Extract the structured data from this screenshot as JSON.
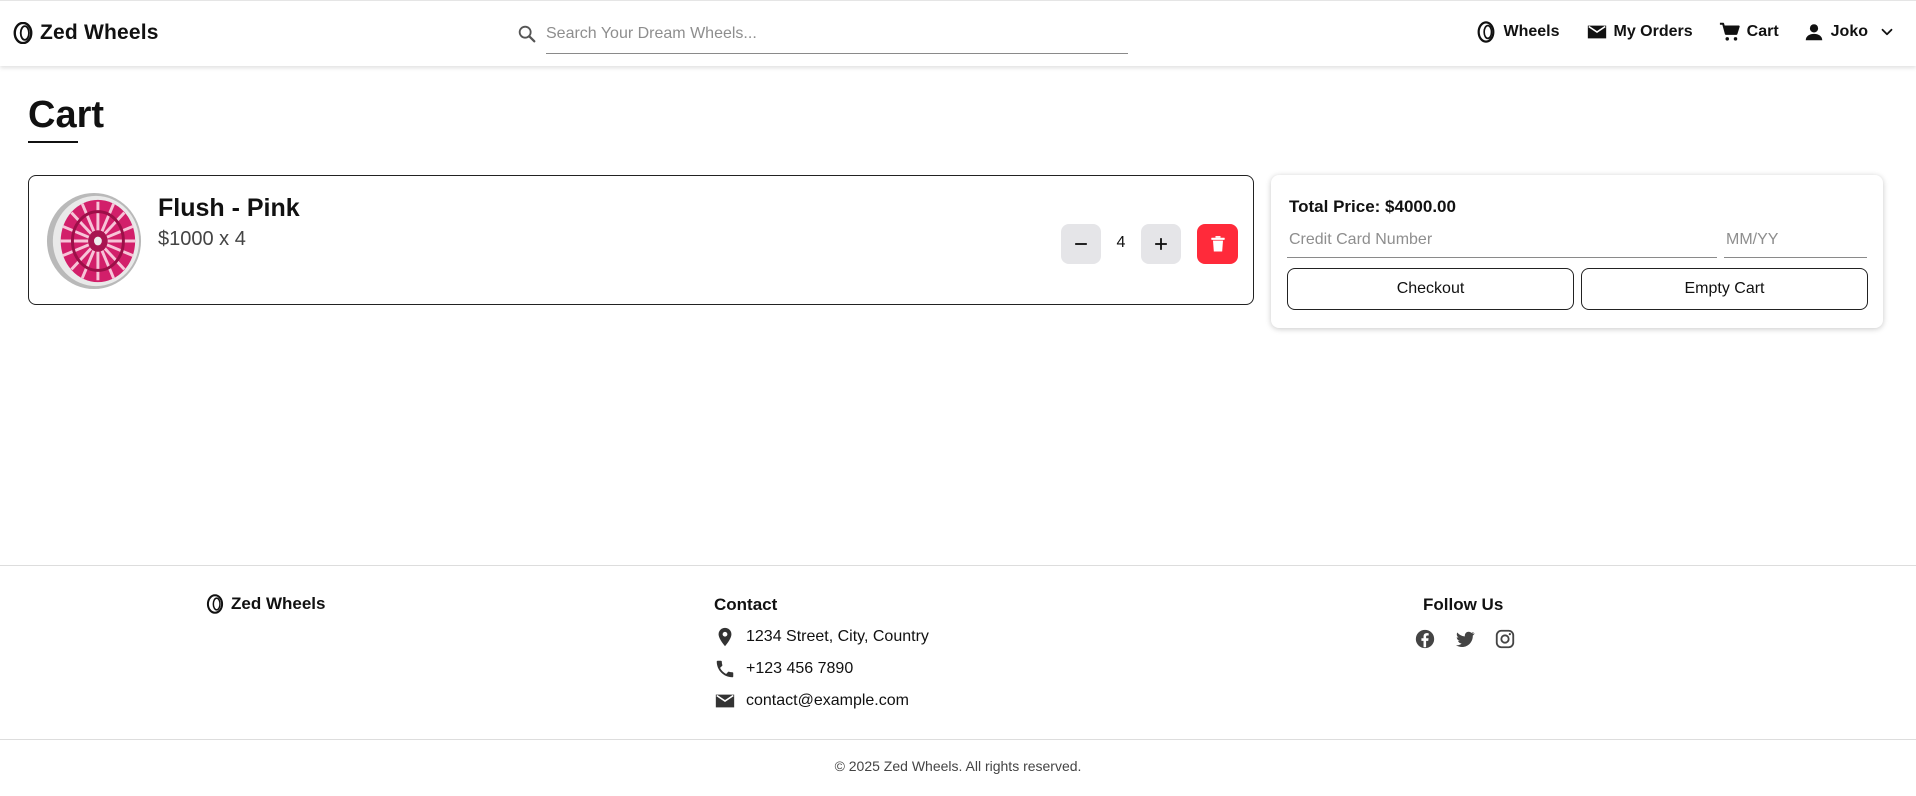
{
  "brand": {
    "name": "Zed Wheels",
    "icon": "tire-icon"
  },
  "search": {
    "placeholder": "Search Your Dream Wheels..."
  },
  "nav": {
    "wheels_label": "Wheels",
    "orders_label": "My Orders",
    "cart_label": "Cart",
    "user_label": "Joko"
  },
  "page": {
    "title": "Cart"
  },
  "cart": {
    "items": [
      {
        "name": "Flush - Pink",
        "price_line": "$1000 x 4",
        "quantity": "4",
        "image": "pink-wheel"
      }
    ]
  },
  "summary": {
    "total_label": "Total Price: $4000.00",
    "card_placeholder": "Credit Card Number",
    "expiry_placeholder": "MM/YY",
    "checkout_label": "Checkout",
    "empty_label": "Empty Cart"
  },
  "footer": {
    "brand_name": "Zed Wheels",
    "contact_title": "Contact",
    "address": "1234 Street, City, Country",
    "phone": "+123 456 7890",
    "email": "contact@example.com",
    "follow_title": "Follow Us",
    "socials": [
      "facebook-icon",
      "twitter-icon",
      "instagram-icon"
    ],
    "copyright": "© 2025 Zed Wheels. All rights reserved."
  },
  "colors": {
    "danger": "#ff2a3a",
    "qty_button": "#e5e5e8",
    "accent_wheel": "#d21f6a"
  }
}
